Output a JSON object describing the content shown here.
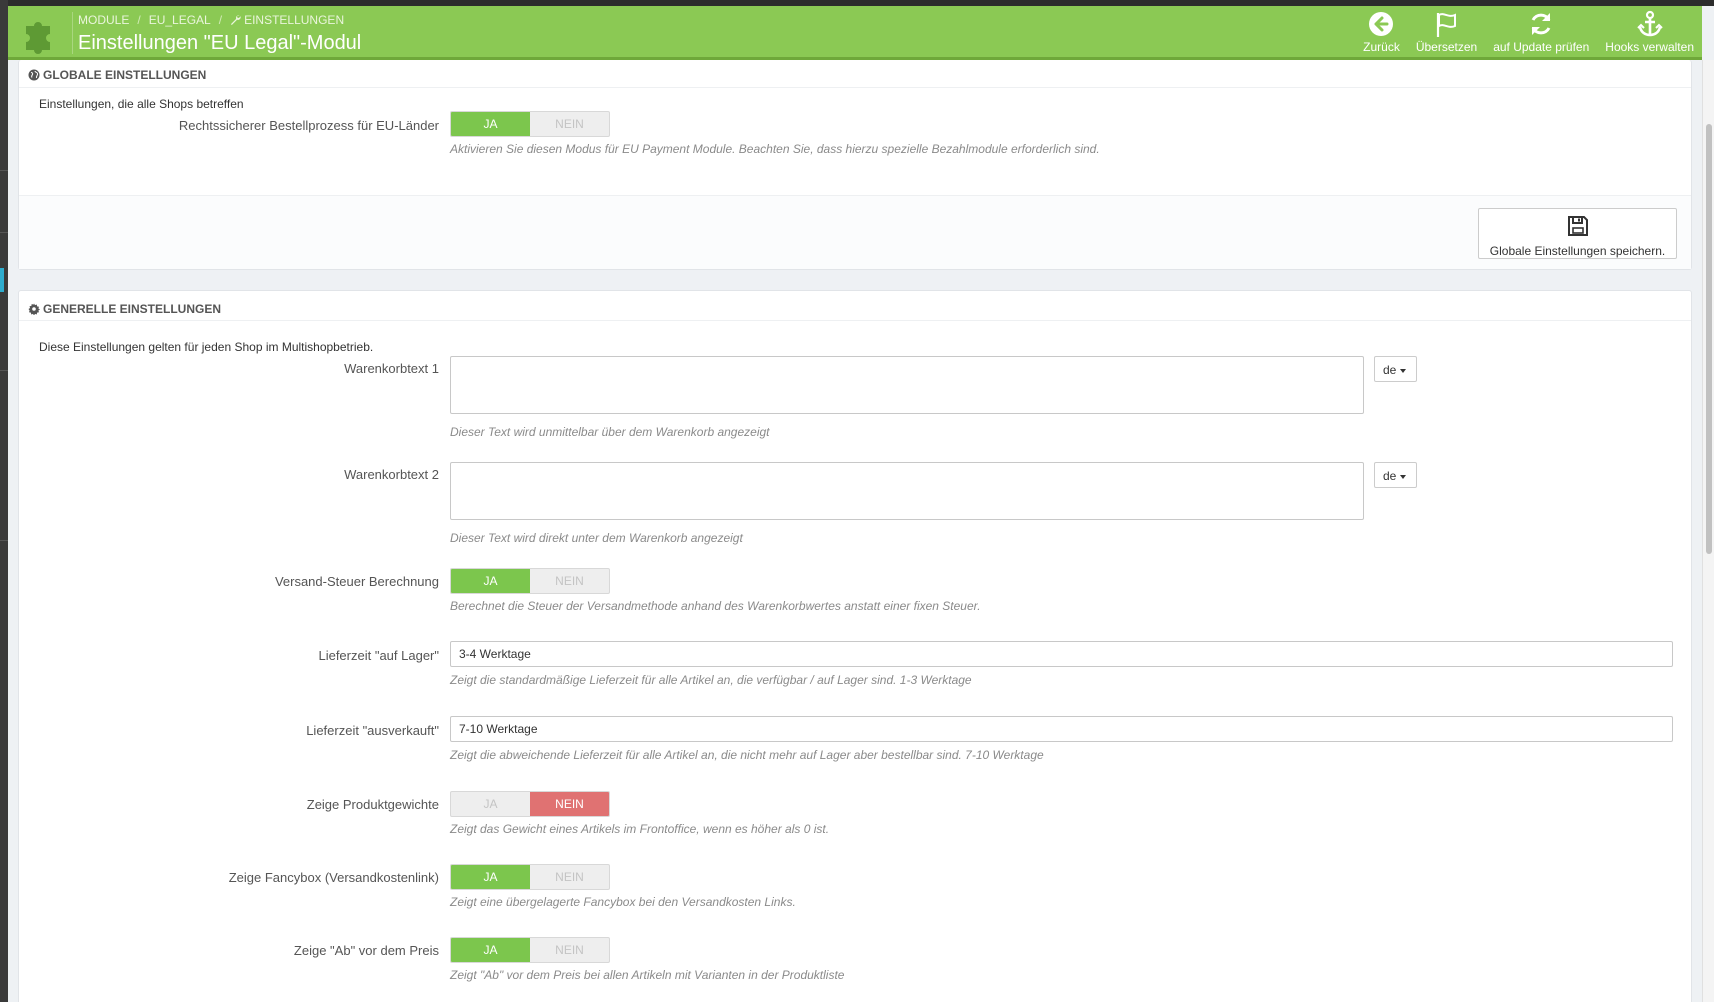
{
  "breadcrumb": {
    "module": "MODULE",
    "eu_legal": "EU_LEGAL",
    "settings": "EINSTELLUNGEN"
  },
  "page_title": "Einstellungen \"EU Legal\"-Modul",
  "toolbar": {
    "back": "Zurück",
    "translate": "Übersetzen",
    "update": "auf Update prüfen",
    "hooks": "Hooks verwalten"
  },
  "colors": {
    "accent": "#8bc954",
    "switch_on": "#7cc64d",
    "switch_off_active": "#e07272"
  },
  "global": {
    "heading": "GLOBALE EINSTELLUNGEN",
    "intro": "Einstellungen, die alle Shops betreffen",
    "eu_checkout": {
      "label": "Rechtssicherer Bestellprozess für EU-Länder",
      "yes": "JA",
      "no": "NEIN",
      "value": "JA",
      "help": "Aktivieren Sie diesen Modus für EU Payment Module. Beachten Sie, dass hierzu spezielle Bezahlmodule erforderlich sind."
    },
    "save_label": "Globale Einstellungen speichern."
  },
  "general": {
    "heading": "GENERELLE EINSTELLUNGEN",
    "intro": "Diese Einstellungen gelten für jeden Shop im Multishopbetrieb.",
    "cart_text_1": {
      "label": "Warenkorbtext 1",
      "value": "",
      "lang": "de",
      "help": "Dieser Text wird unmittelbar über dem Warenkorb angezeigt"
    },
    "cart_text_2": {
      "label": "Warenkorbtext 2",
      "value": "",
      "lang": "de",
      "help": "Dieser Text wird direkt unter dem Warenkorb angezeigt"
    },
    "shipping_tax": {
      "label": "Versand-Steuer Berechnung",
      "yes": "JA",
      "no": "NEIN",
      "value": "JA",
      "help": "Berechnet die Steuer der Versandmethode anhand des Warenkorbwertes anstatt einer fixen Steuer."
    },
    "delivery_in_stock": {
      "label": "Lieferzeit \"auf Lager\"",
      "value": "3-4 Werktage",
      "help": "Zeigt die standardmäßige Lieferzeit für alle Artikel an, die verfügbar / auf Lager sind. 1-3 Werktage"
    },
    "delivery_sold_out": {
      "label": "Lieferzeit \"ausverkauft\"",
      "value": "7-10 Werktage",
      "help": "Zeigt die abweichende Lieferzeit für alle Artikel an, die nicht mehr auf Lager aber bestellbar sind. 7-10 Werktage"
    },
    "show_weight": {
      "label": "Zeige Produktgewichte",
      "yes": "JA",
      "no": "NEIN",
      "value": "NEIN",
      "help": "Zeigt das Gewicht eines Artikels im Frontoffice, wenn es höher als 0 ist."
    },
    "show_fancybox": {
      "label": "Zeige Fancybox (Versandkostenlink)",
      "yes": "JA",
      "no": "NEIN",
      "value": "JA",
      "help": "Zeigt eine übergelagerte Fancybox bei den Versandkosten Links."
    },
    "show_from": {
      "label": "Zeige \"Ab\" vor dem Preis",
      "yes": "JA",
      "no": "NEIN",
      "value": "JA",
      "help": "Zeigt \"Ab\" vor dem Preis bei allen Artikeln mit Varianten in der Produktliste"
    }
  }
}
